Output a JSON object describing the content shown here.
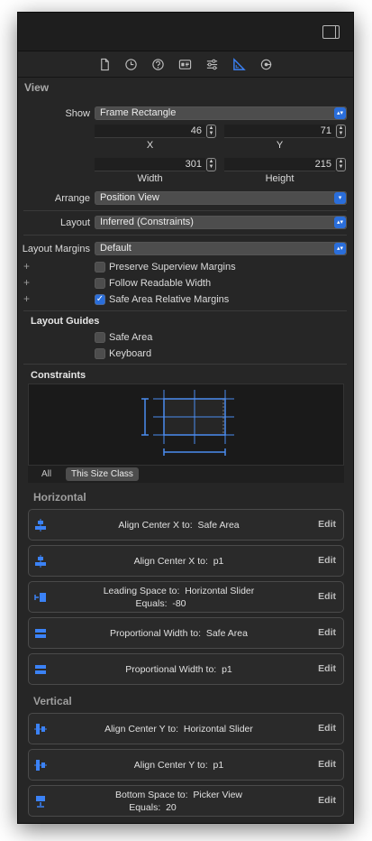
{
  "colors": {
    "accent": "#2a6edb",
    "panel_bg": "#262626",
    "control_bg": "#4d4d4d"
  },
  "toolbar": {
    "icons": [
      "file-icon",
      "history-icon",
      "help-icon",
      "identity-icon",
      "attributes-icon",
      "size-ruler-icon",
      "connections-icon"
    ],
    "selected": "size-ruler-icon"
  },
  "view_section": {
    "title": "View",
    "show_label": "Show",
    "show_value": "Frame Rectangle",
    "x_value": "46",
    "x_label": "X",
    "y_value": "71",
    "y_label": "Y",
    "width_value": "301",
    "width_label": "Width",
    "height_value": "215",
    "height_label": "Height",
    "arrange_label": "Arrange",
    "arrange_value": "Position View",
    "layout_label": "Layout",
    "layout_value": "Inferred (Constraints)",
    "margins_label": "Layout Margins",
    "margins_value": "Default",
    "checks": [
      {
        "label": "Preserve Superview Margins",
        "checked": false
      },
      {
        "label": "Follow Readable Width",
        "checked": false
      },
      {
        "label": "Safe Area Relative Margins",
        "checked": true
      }
    ]
  },
  "layout_guides": {
    "title": "Layout Guides",
    "checks": [
      {
        "label": "Safe Area",
        "checked": false
      },
      {
        "label": "Keyboard",
        "checked": false
      }
    ]
  },
  "constraints": {
    "title": "Constraints",
    "filter_all": "All",
    "filter_size_class": "This Size Class"
  },
  "horizontal": {
    "title": "Horizontal",
    "rows": [
      {
        "line1_key": "Align Center X to:",
        "line1_val": "Safe Area",
        "line2_key": "",
        "line2_val": "",
        "icon": "align-center-x-icon",
        "edit": "Edit"
      },
      {
        "line1_key": "Align Center X to:",
        "line1_val": "p1",
        "line2_key": "",
        "line2_val": "",
        "icon": "align-center-x-icon",
        "edit": "Edit"
      },
      {
        "line1_key": "Leading Space to:",
        "line1_val": "Horizontal Slider",
        "line2_key": "Equals:",
        "line2_val": "-80",
        "icon": "leading-space-icon",
        "edit": "Edit"
      },
      {
        "line1_key": "Proportional Width to:",
        "line1_val": "Safe Area",
        "line2_key": "",
        "line2_val": "",
        "icon": "proportional-width-icon",
        "edit": "Edit"
      },
      {
        "line1_key": "Proportional Width to:",
        "line1_val": "p1",
        "line2_key": "",
        "line2_val": "",
        "icon": "proportional-width-icon",
        "edit": "Edit"
      }
    ]
  },
  "vertical": {
    "title": "Vertical",
    "rows": [
      {
        "line1_key": "Align Center Y to:",
        "line1_val": "Horizontal Slider",
        "line2_key": "",
        "line2_val": "",
        "icon": "align-center-y-icon",
        "edit": "Edit"
      },
      {
        "line1_key": "Align Center Y to:",
        "line1_val": "p1",
        "line2_key": "",
        "line2_val": "",
        "icon": "align-center-y-icon",
        "edit": "Edit"
      },
      {
        "line1_key": "Bottom Space to:",
        "line1_val": "Picker View",
        "line2_key": "Equals:",
        "line2_val": "20",
        "icon": "bottom-space-icon",
        "edit": "Edit"
      }
    ]
  }
}
